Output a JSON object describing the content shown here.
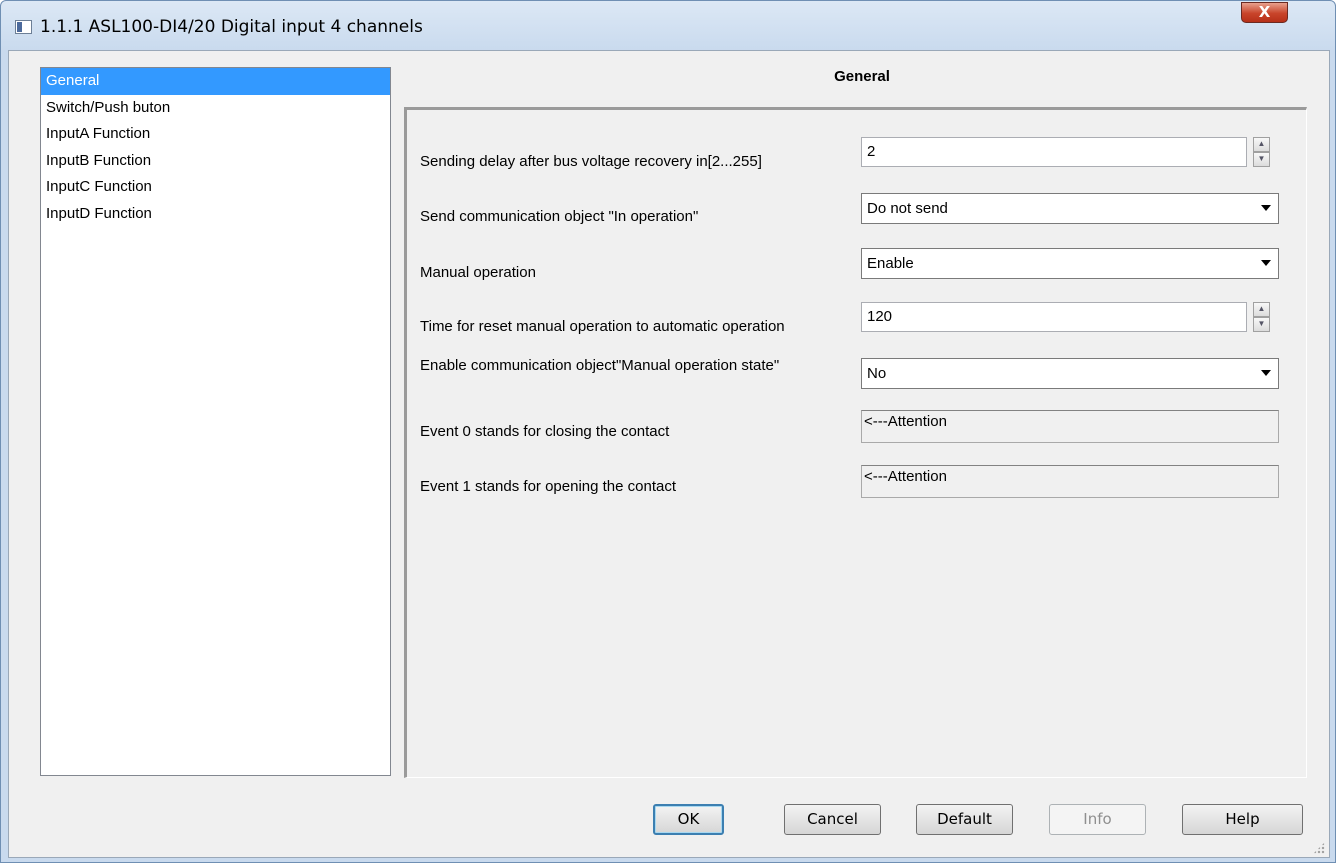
{
  "window": {
    "title": "1.1.1 ASL100-DI4/20 Digital input 4 channels",
    "close_label": "X",
    "icon": "app-window-icon"
  },
  "nav": {
    "items": [
      {
        "label": "General",
        "selected": true
      },
      {
        "label": "Switch/Push buton",
        "selected": false
      },
      {
        "label": "InputA Function",
        "selected": false
      },
      {
        "label": "InputB Function",
        "selected": false
      },
      {
        "label": "InputC Function",
        "selected": false
      },
      {
        "label": "InputD Function",
        "selected": false
      }
    ]
  },
  "panel": {
    "title": "General",
    "rows": [
      {
        "label": "Sending delay after bus voltage recovery in[2...255]",
        "value": "2"
      },
      {
        "label": "Send communication object \"In operation\"",
        "value": "Do not send"
      },
      {
        "label": "Manual operation",
        "value": "Enable"
      },
      {
        "label": "Time for reset manual operation to automatic operation",
        "value": "120"
      },
      {
        "label": "Enable communication object\"Manual operation state\"",
        "value": "No"
      },
      {
        "label": "Event 0 stands for closing the contact",
        "value": "<---Attention"
      },
      {
        "label": "Event 1 stands for opening the contact",
        "value": "<---Attention"
      }
    ]
  },
  "buttons": {
    "ok": "OK",
    "cancel": "Cancel",
    "default": "Default",
    "info": "Info",
    "help": "Help"
  },
  "colors": {
    "selection": "#3399ff",
    "window_frame": "#c9daee",
    "close_button": "#c8442a"
  }
}
